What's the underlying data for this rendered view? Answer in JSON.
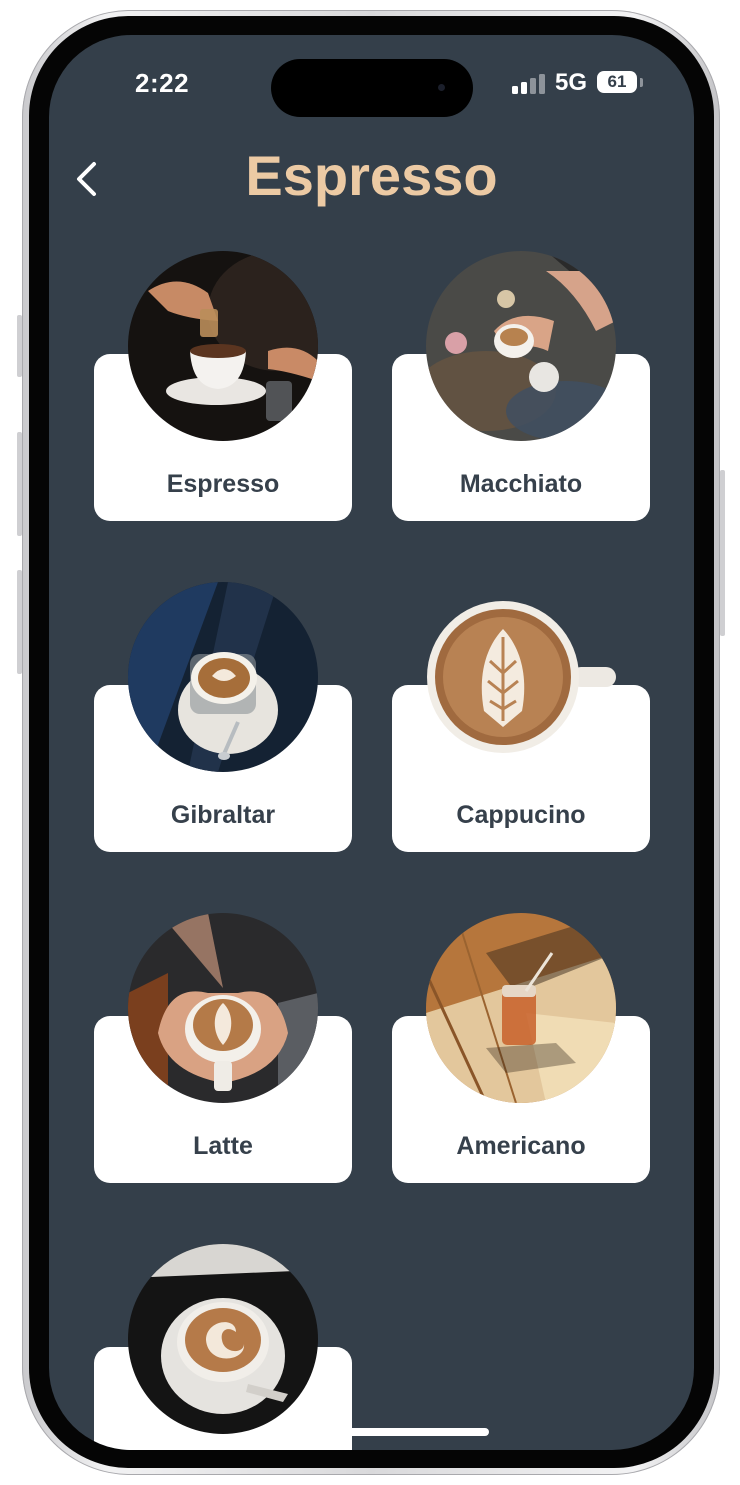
{
  "status_bar": {
    "time": "2:22",
    "network": "5G",
    "battery": "61"
  },
  "header": {
    "title": "Espresso",
    "back_icon": "chevron-left-icon"
  },
  "colors": {
    "background": "#343f4a",
    "title": "#eccaa4",
    "card": "#ffffff",
    "card_text": "#36404b"
  },
  "drinks": [
    {
      "label": "Espresso"
    },
    {
      "label": "Macchiato"
    },
    {
      "label": "Gibraltar"
    },
    {
      "label": "Cappucino"
    },
    {
      "label": "Latte"
    },
    {
      "label": "Americano"
    },
    {
      "label": ""
    }
  ]
}
